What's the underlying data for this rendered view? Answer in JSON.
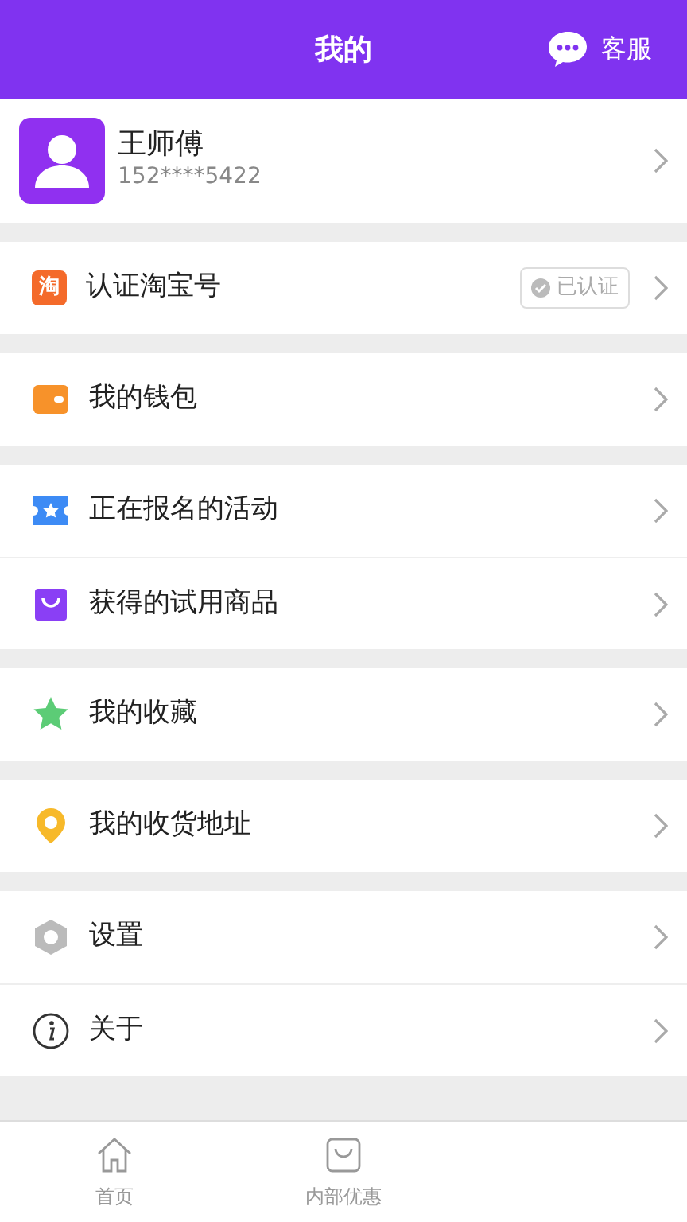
{
  "header": {
    "title": "我的",
    "service_label": "客服"
  },
  "profile": {
    "name": "王师傅",
    "phone": "152****5422"
  },
  "groups": [
    [
      {
        "kind": "taobao",
        "icon_text": "淘",
        "label": "认证淘宝号",
        "badge": "已认证"
      }
    ],
    [
      {
        "kind": "wallet",
        "label": "我的钱包"
      }
    ],
    [
      {
        "kind": "ticket",
        "label": "正在报名的活动"
      },
      {
        "kind": "bag",
        "label": "获得的试用商品"
      }
    ],
    [
      {
        "kind": "star",
        "label": "我的收藏"
      }
    ],
    [
      {
        "kind": "pin",
        "label": "我的收货地址"
      }
    ],
    [
      {
        "kind": "hexagon",
        "label": "设置"
      },
      {
        "kind": "info",
        "label": "关于"
      }
    ]
  ],
  "tab_bar": [
    {
      "kind": "home",
      "label": "首页"
    },
    {
      "kind": "bag",
      "label": "内部优惠"
    }
  ]
}
